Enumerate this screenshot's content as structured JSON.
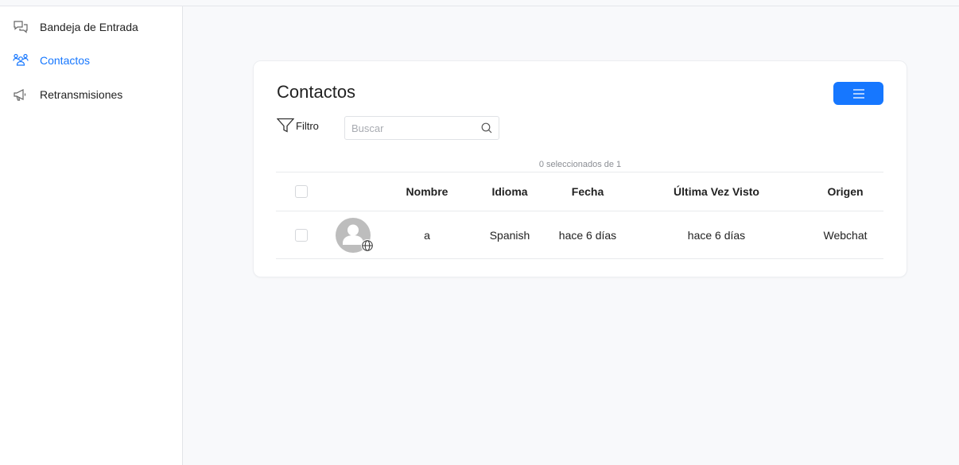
{
  "sidebar": {
    "items": [
      {
        "label": "Bandeja de Entrada",
        "icon": "chat-bubbles-icon",
        "active": false
      },
      {
        "label": "Contactos",
        "icon": "users-icon",
        "active": true
      },
      {
        "label": "Retransmisiones",
        "icon": "megaphone-icon",
        "active": false
      }
    ]
  },
  "main": {
    "title": "Contactos",
    "filter_label": "Filtro",
    "search": {
      "placeholder": "Buscar",
      "value": ""
    },
    "selection_info": "0 seleccionados de 1",
    "columns": [
      "Nombre",
      "Idioma",
      "Fecha",
      "Última Vez Visto",
      "Origen"
    ],
    "rows": [
      {
        "nombre": "a",
        "idioma": "Spanish",
        "fecha": "hace 6 días",
        "ultima_vez": "hace 6 días",
        "origen": "Webchat"
      }
    ]
  },
  "colors": {
    "accent": "#1677ff",
    "background": "#f8f9fb",
    "avatar": "#bdbdbd"
  }
}
